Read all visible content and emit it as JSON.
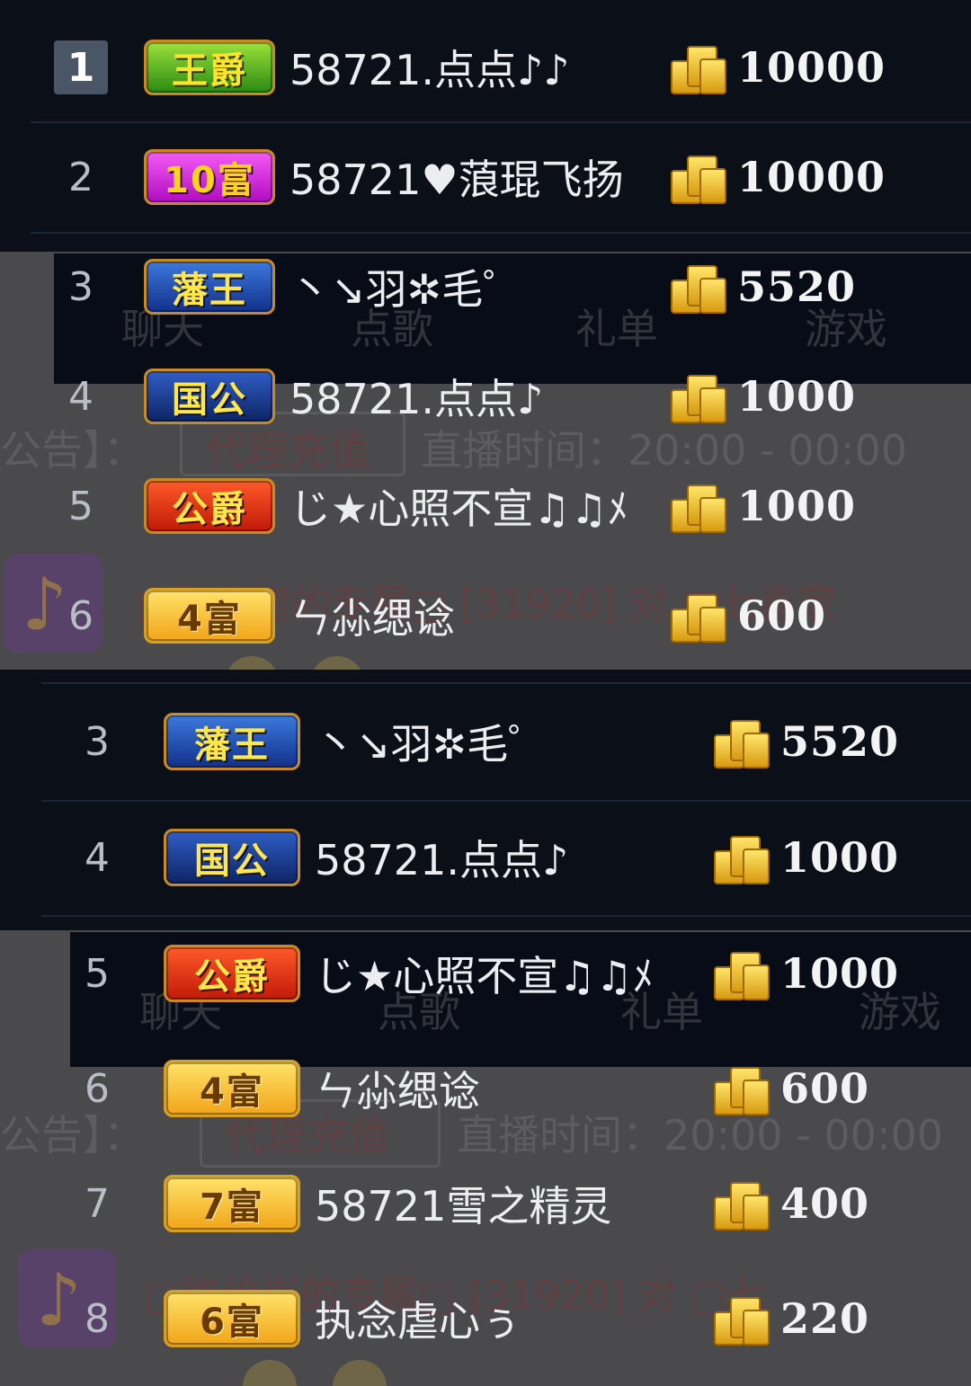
{
  "top_list": {
    "rows": [
      {
        "rank": "1",
        "badge": "王爵",
        "name": "58721.点点♪♪",
        "amount": "10000"
      },
      {
        "rank": "2",
        "badge": "10富",
        "name": "58721♥蒗琨飞扬",
        "amount": "10000"
      },
      {
        "rank": "3",
        "badge": "藩王",
        "name": "丶↘羽✲毛゜",
        "amount": "5520"
      },
      {
        "rank": "4",
        "badge": "国公",
        "name": "58721.点点♪",
        "amount": "1000"
      },
      {
        "rank": "5",
        "badge": "公爵",
        "name": "じ★心照不宣♫♫ﾒ",
        "amount": "1000"
      },
      {
        "rank": "6",
        "badge": "4富",
        "name": "ㄣ尛缌谂",
        "amount": "600"
      }
    ]
  },
  "bottom_list": {
    "rows": [
      {
        "rank": "3",
        "badge": "藩王",
        "name": "丶↘羽✲毛゜",
        "amount": "5520"
      },
      {
        "rank": "4",
        "badge": "国公",
        "name": "58721.点点♪",
        "amount": "1000"
      },
      {
        "rank": "5",
        "badge": "公爵",
        "name": "じ★心照不宣♫♫ﾒ",
        "amount": "1000"
      },
      {
        "rank": "6",
        "badge": "4富",
        "name": "ㄣ尛缌谂",
        "amount": "600"
      },
      {
        "rank": "7",
        "badge": "7富",
        "name": "58721雪之精灵",
        "amount": "400"
      },
      {
        "rank": "8",
        "badge": "6富",
        "name": "执念虐心ぅ",
        "amount": "220"
      }
    ]
  },
  "background_ui": {
    "tabs": [
      "聊天",
      "点歌",
      "礼单",
      "游戏"
    ],
    "notice_label": "公告】：",
    "recharge_button": "代理充值",
    "broadcast_time": "直播时间：20:00 - 00:00",
    "chat_line_top": "□路给崖的专属□ [31920] 对 □七喜家",
    "chat_line_bottom": "□路给崖的专属□ [31920] 对 □七"
  },
  "icons": {
    "coin": "gold-coins-icon",
    "music": "music-note-icon"
  }
}
